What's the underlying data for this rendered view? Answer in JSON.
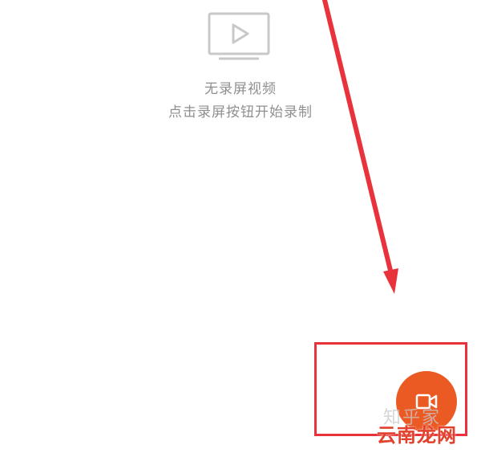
{
  "empty_state": {
    "icon": "video-play-icon",
    "title": "无录屏视频",
    "hint": "点击录屏按钮开始录制"
  },
  "record_button": {
    "icon": "video-camera-icon",
    "color": "#ec5a23"
  },
  "annotation": {
    "arrow_color": "#e8323c",
    "box_color": "#e8323c"
  },
  "watermark": {
    "top_text": "知乎家",
    "text": "云南龙网"
  }
}
